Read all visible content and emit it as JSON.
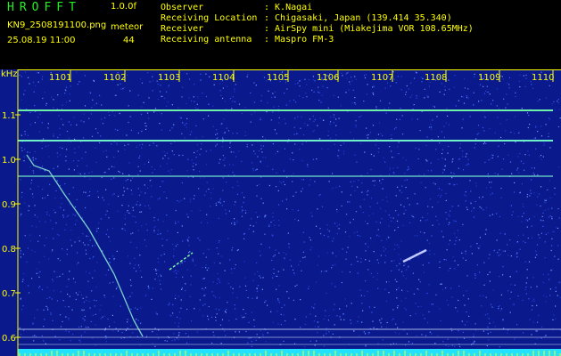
{
  "header": {
    "app_title": "HROFFT",
    "version": "1.0.0f",
    "file_name": "KN9_2508191100.png",
    "mode": "meteor",
    "date_time": "25.08.19 11:00",
    "count": "44",
    "info": [
      {
        "label": "Observer",
        "value": ": K.Nagai"
      },
      {
        "label": "Receiving Location",
        "value": ": Chigasaki, Japan (139.414 35.340)"
      },
      {
        "label": "Receiver",
        "value": ": AirSpy mini (Miakejima VOR 108.65MHz)"
      },
      {
        "label": "Receiving antenna",
        "value": ": Maspro FM-3"
      }
    ]
  },
  "spectrogram": {
    "y_unit": "kHz",
    "y_ticks": [
      "1.1",
      "1.0",
      "0.9",
      "0.8",
      "0.7",
      "0.6"
    ],
    "x_ticks": [
      "1101",
      "1102",
      "1103",
      "1104",
      "1105",
      "1106",
      "1107",
      "1108",
      "1109",
      "1110"
    ],
    "background": "#0a1a8c",
    "text_color": "#ffff00",
    "trace_color": "#7ff5c8"
  }
}
